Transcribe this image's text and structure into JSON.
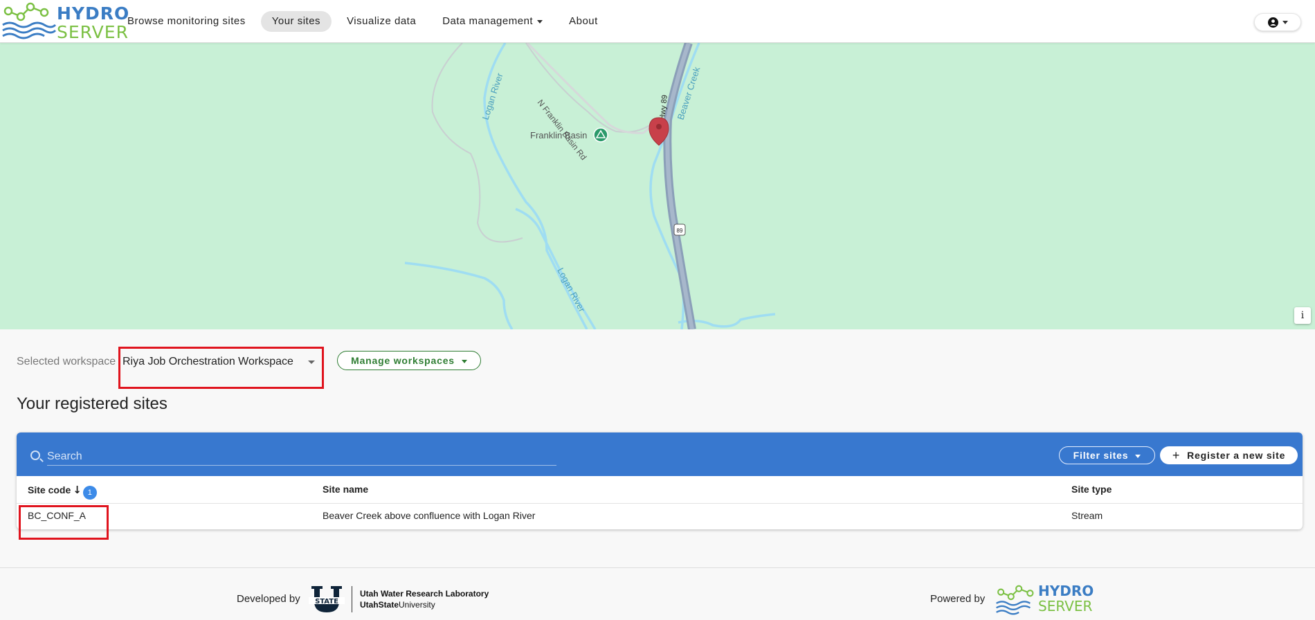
{
  "brand": {
    "line1": "HYDRO",
    "line2": "SERVER"
  },
  "nav": {
    "browse": "Browse monitoring sites",
    "your_sites": "Your sites",
    "visualize": "Visualize data",
    "data_management": "Data management",
    "about": "About"
  },
  "map": {
    "labels": {
      "franklin_basin_rd": "N Franklin Basin Rd",
      "franklin_basin": "Franklin Basin",
      "logan_river_1": "Logan River",
      "logan_river_2": "Logan River",
      "beaver_creek": "Beaver Creek",
      "hwy": "Hwy 89",
      "shield": "89"
    },
    "info": "i"
  },
  "workspace": {
    "label": "Selected workspace",
    "value": "Riya Job Orchestration Workspace",
    "manage_label": "Manage workspaces"
  },
  "sites": {
    "title": "Your registered sites",
    "search_placeholder": "Search",
    "filter_label": "Filter sites",
    "register_label": "Register a new site",
    "columns": {
      "code": "Site code",
      "name": "Site name",
      "type": "Site type"
    },
    "sort_badge": "1",
    "rows": [
      {
        "code": "BC_CONF_A",
        "name": "Beaver Creek above confluence with Logan River",
        "type": "Stream"
      }
    ]
  },
  "footer": {
    "developed_by": "Developed by",
    "usu_logo_text": "STATE",
    "uwrl_line1": "Utah Water Research Laboratory",
    "uwrl_line2_bold": "UtahState",
    "uwrl_line2_rest": "University",
    "powered_by": "Powered by",
    "logo_line1": "HYDRO",
    "logo_line2": "SERVER"
  },
  "colors": {
    "accent_blue": "#3878cf",
    "green": "#2e7d32",
    "highlight_red": "#e0141e",
    "map_bg": "#c8f0d6",
    "marker": "#c8404a"
  }
}
